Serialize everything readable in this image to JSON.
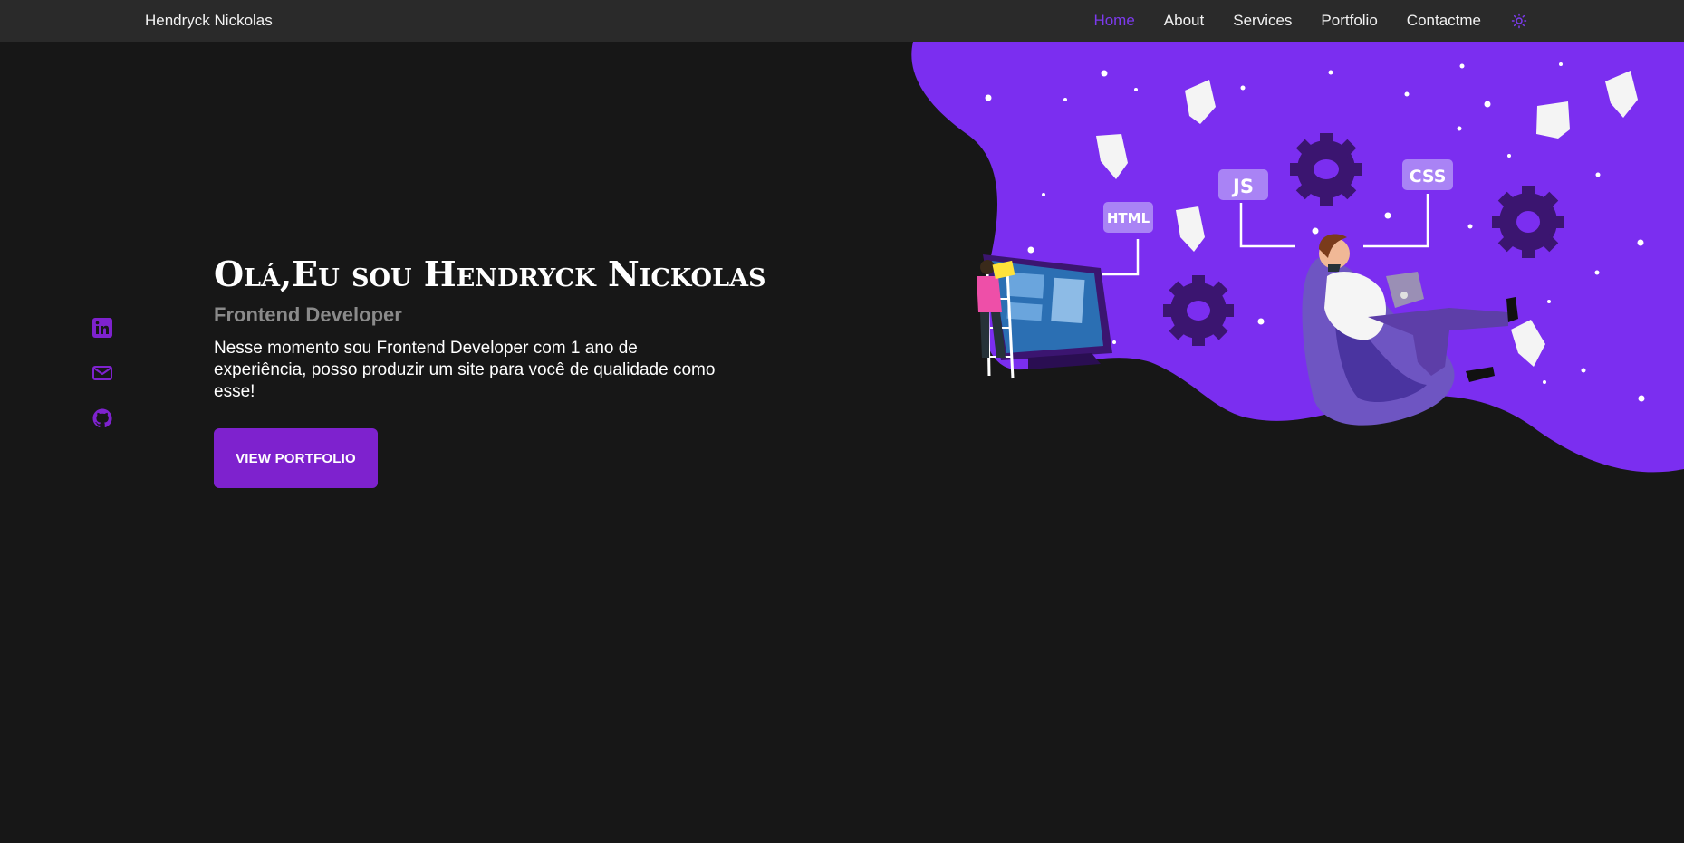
{
  "nav": {
    "brand": "Hendryck Nickolas",
    "links": [
      {
        "label": "Home",
        "active": true
      },
      {
        "label": "About"
      },
      {
        "label": "Services"
      },
      {
        "label": "Portfolio"
      },
      {
        "label": "Contactme"
      }
    ],
    "theme_icon": "sun-icon"
  },
  "social": [
    {
      "icon": "linkedin-icon"
    },
    {
      "icon": "mail-icon"
    },
    {
      "icon": "github-icon"
    }
  ],
  "hero": {
    "title": "Olá,Eu sou Hendryck Nickolas",
    "subtitle": "Frontend Developer",
    "description": "Nesse momento sou Frontend Developer com 1 ano de experiência, posso produzir um site para você de qualidade como esse!",
    "cta_label": "VIEW PORTFOLIO"
  },
  "illustration": {
    "tags": [
      "HTML",
      "JS",
      "CSS"
    ]
  },
  "colors": {
    "accent": "#7c3aed",
    "button": "#7e22ce",
    "background": "#171717",
    "navbar": "#2a2a2a"
  }
}
